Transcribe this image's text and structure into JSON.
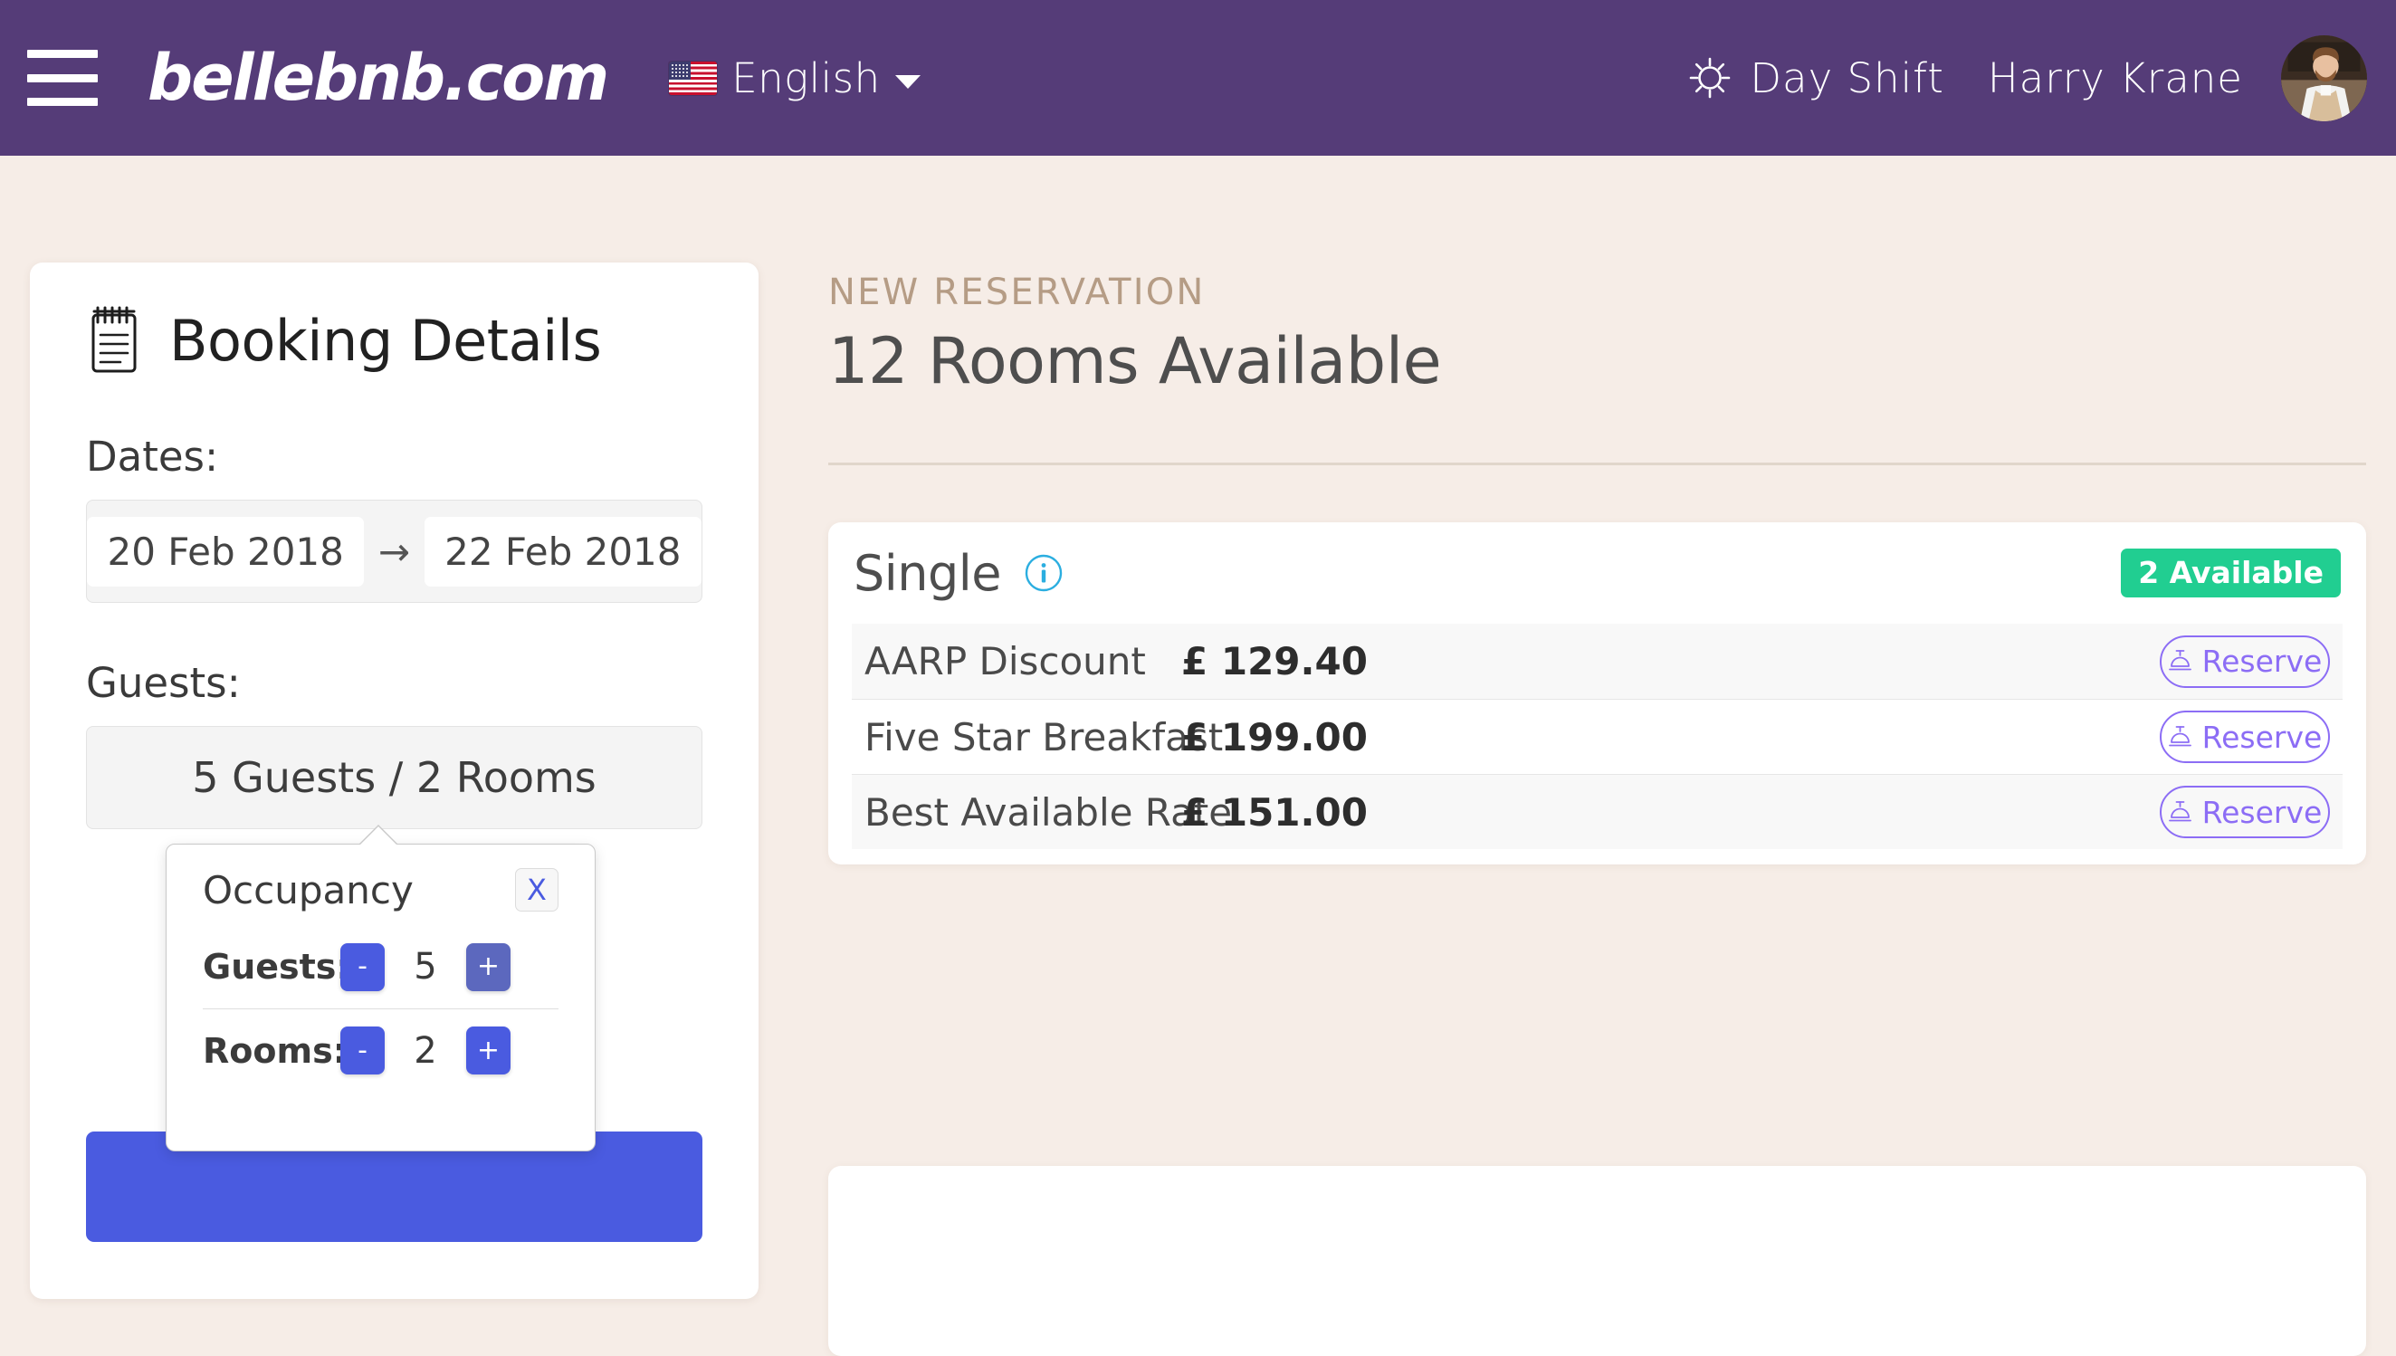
{
  "header": {
    "menu_icon": "hamburger-icon",
    "brand": "bellebnb.com",
    "language": {
      "flag_icon": "us-flag-icon",
      "label": "English",
      "caret_icon": "chevron-down-icon"
    },
    "shift": {
      "icon": "sun-icon",
      "label": "Day Shift"
    },
    "user": {
      "name": "Harry Krane",
      "avatar_icon": "user-avatar"
    },
    "background_color": "#553C78"
  },
  "booking_panel": {
    "icon": "notepad-icon",
    "title": "Booking Details",
    "dates_label": "Dates:",
    "check_in": "20 Feb 2018",
    "date_separator": "→",
    "check_out": "22 Feb 2018",
    "guests_label": "Guests:",
    "occupancy_summary": "5 Guests / 2 Rooms",
    "primary_button_color": "#4A5BE0"
  },
  "occupancy_popover": {
    "title": "Occupancy",
    "close_label": "X",
    "rows": [
      {
        "label": "Guests:",
        "decrement": "-",
        "value": "5",
        "increment": "+",
        "increment_state": "muted"
      },
      {
        "label": "Rooms:",
        "decrement": "-",
        "value": "2",
        "increment": "+",
        "increment_state": "normal"
      }
    ]
  },
  "main": {
    "eyebrow": "NEW RESERVATION",
    "title": "12 Rooms Available",
    "accent_color": "#B59C85"
  },
  "room_cards": [
    {
      "name": "Single",
      "info_icon": "info-circle-icon",
      "availability_badge": "2 Available",
      "badge_color": "#21CE91",
      "rates": [
        {
          "name": "AARP Discount",
          "price": "£ 129.40",
          "button_label": "Reserve",
          "button_icon": "service-bell-icon"
        },
        {
          "name": "Five Star Breakfast",
          "price": "£ 199.00",
          "button_label": "Reserve",
          "button_icon": "service-bell-icon"
        },
        {
          "name": "Best Available Rate",
          "price": "£ 151.00",
          "button_label": "Reserve",
          "button_icon": "service-bell-icon"
        }
      ]
    }
  ]
}
